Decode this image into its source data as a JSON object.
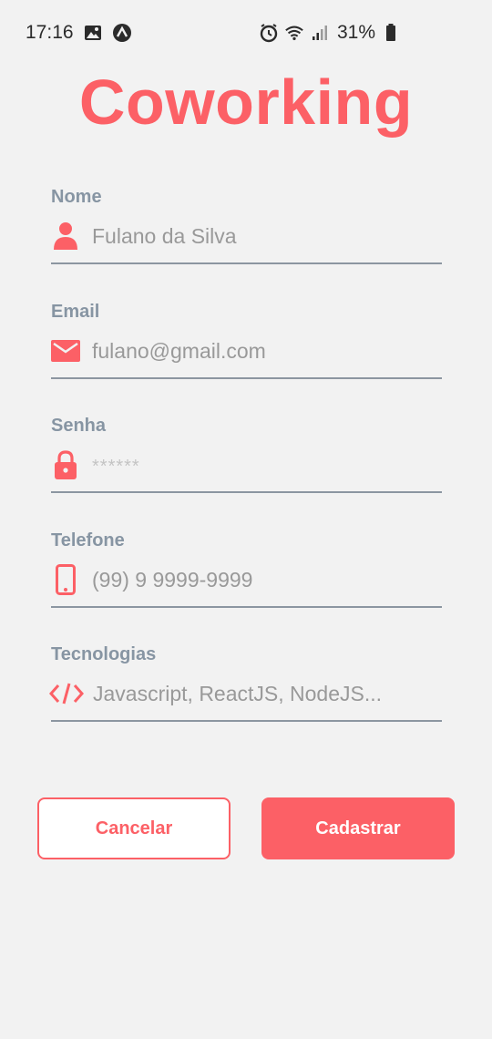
{
  "status_bar": {
    "time": "17:16",
    "battery": "31%",
    "icons": [
      "image-icon",
      "nav-icon",
      "alarm-icon",
      "wifi-icon",
      "signal-icon",
      "battery-icon"
    ]
  },
  "app": {
    "title": "Coworking",
    "accent_color": "#fc6066"
  },
  "form": {
    "fields": [
      {
        "label": "Nome",
        "placeholder": "Fulano da Silva",
        "icon": "user-icon"
      },
      {
        "label": "Email",
        "placeholder": "fulano@gmail.com",
        "icon": "mail-icon"
      },
      {
        "label": "Senha",
        "placeholder": "******",
        "icon": "lock-icon"
      },
      {
        "label": "Telefone",
        "placeholder": "(99) 9 9999-9999",
        "icon": "phone-icon"
      },
      {
        "label": "Tecnologias",
        "placeholder": "Javascript, ReactJS, NodeJS...",
        "icon": "code-icon"
      }
    ]
  },
  "actions": {
    "cancel_label": "Cancelar",
    "submit_label": "Cadastrar"
  }
}
